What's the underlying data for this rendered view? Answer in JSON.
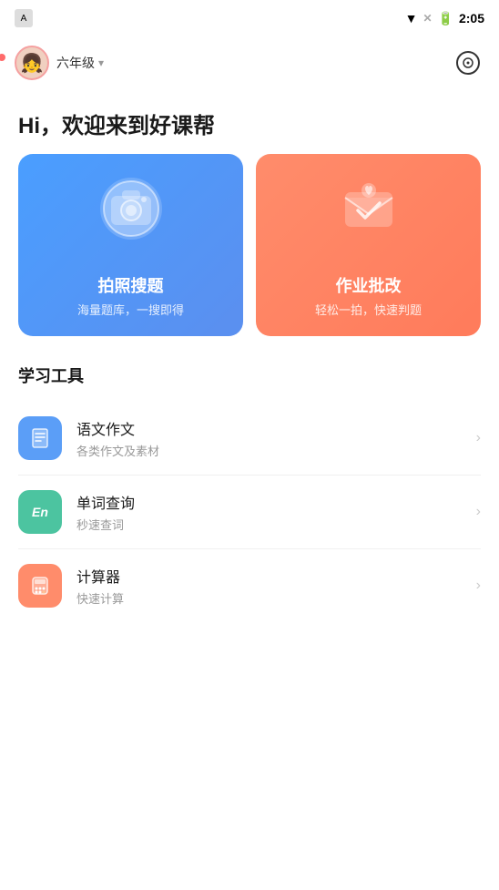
{
  "statusBar": {
    "time": "2:05",
    "appIconLabel": "A"
  },
  "topNav": {
    "gradeLabel": "六年级",
    "dropdownIcon": "▾",
    "avatarEmoji": "👧"
  },
  "greeting": {
    "text": "Hi，欢迎来到好课帮"
  },
  "cards": [
    {
      "id": "photo-search",
      "title": "拍照搜题",
      "subtitle": "海量题库，一搜即得",
      "bgClass": "card-blue"
    },
    {
      "id": "homework-review",
      "title": "作业批改",
      "subtitle": "轻松一拍，快速判题",
      "bgClass": "card-orange"
    }
  ],
  "learningTools": {
    "sectionTitle": "学习工具",
    "items": [
      {
        "id": "chinese-essay",
        "name": "语文作文",
        "desc": "各类作文及素材",
        "iconColor": "tool-icon-blue",
        "iconSymbol": "✏️"
      },
      {
        "id": "word-lookup",
        "name": "单词查询",
        "desc": "秒速查词",
        "iconColor": "tool-icon-green",
        "iconSymbol": "En"
      },
      {
        "id": "calculator",
        "name": "计算器",
        "desc": "快速计算",
        "iconColor": "tool-icon-orange",
        "iconSymbol": "🔢"
      }
    ]
  },
  "colors": {
    "cardBlue": "#5b9ef7",
    "cardOrange": "#ff8c6b",
    "iconGreen": "#4cc4a0"
  }
}
